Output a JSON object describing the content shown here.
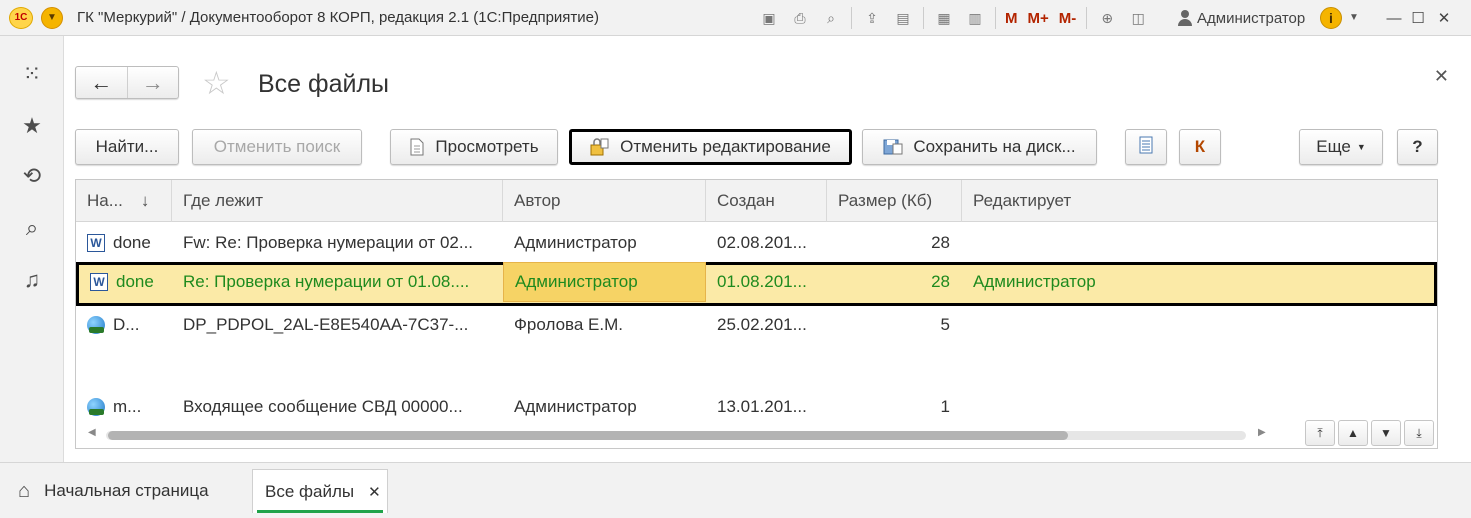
{
  "titlebar": {
    "app_title": "ГК \"Меркурий\" / Документооборот 8 КОРП, редакция 2.1  (1С:Предприятие)",
    "logo": "1С",
    "m_buttons": [
      "M",
      "M+",
      "M-"
    ],
    "user": "Администратор"
  },
  "page": {
    "title": "Все файлы"
  },
  "toolbar": {
    "find": "Найти...",
    "cancel_search": "Отменить поиск",
    "view": "Просмотреть",
    "cancel_edit": "Отменить редактирование",
    "save_to_disk": "Сохранить на диск...",
    "k_label": "К",
    "more": "Еще",
    "help": "?"
  },
  "table": {
    "columns": [
      "На...",
      "Где лежит",
      "Автор",
      "Создан",
      "Размер (Кб)",
      "Редактирует"
    ],
    "sort_indicator": "↓",
    "rows": [
      {
        "name": "done",
        "location": "Fw: Re: Проверка нумерации от 02...",
        "author": "Администратор",
        "created": "02.08.201...",
        "size": "28",
        "editor": "",
        "icon": "word-icon"
      },
      {
        "name": "done",
        "location": "Re: Проверка нумерации от 01.08....",
        "author": "Администратор",
        "created": "01.08.201...",
        "size": "28",
        "editor": "Администратор",
        "icon": "word-icon"
      },
      {
        "name": "D...",
        "location": "DP_PDPOL_2AL-E8E540AA-7C37-...",
        "author": "Фролова Е.М.",
        "created": "25.02.201...",
        "size": "5",
        "editor": "",
        "icon": "globe-icon"
      },
      {
        "name": "m...",
        "location": "Входящее сообщение СВД 00000...",
        "author": "Администратор",
        "created": "13.01.201...",
        "size": "1",
        "editor": "",
        "icon": "globe-icon"
      }
    ]
  },
  "bottom": {
    "home_tab": "Начальная страница",
    "doc_tab": "Все файлы"
  }
}
